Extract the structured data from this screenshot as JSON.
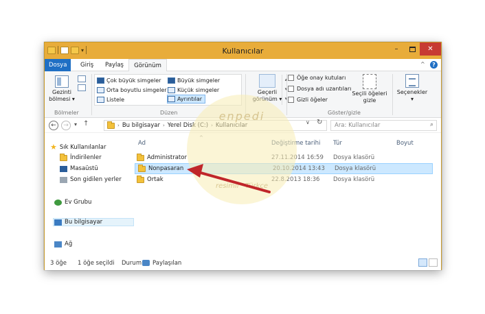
{
  "window": {
    "title": "Kullanıcılar",
    "min": "–",
    "close": "✕"
  },
  "tabs": {
    "file": "Dosya",
    "home": "Giriş",
    "share": "Paylaş",
    "view": "Görünüm"
  },
  "ribbon": {
    "panes": {
      "nav_pane": "Gezinti\nbölmesi ▾",
      "group_label": "Bölmeler"
    },
    "layout": {
      "items": [
        "Çok büyük simgeler",
        "Büyük simgeler",
        "Orta boyutlu simgeler",
        "Küçük simgeler",
        "Listele",
        "Ayrıntılar"
      ],
      "group_label": "Düzen"
    },
    "current_view": {
      "label": "Geçerli\ngörünüm ▾"
    },
    "show_hide": {
      "item_checkboxes": "Öğe onay kutuları",
      "file_extensions": "Dosya adı uzantıları",
      "hidden_items": "Gizli öğeler",
      "hide_selected": "Seçili öğeleri\ngizle",
      "group_label": "Göster/gizle"
    },
    "options": {
      "label": "Seçenekler\n▾"
    }
  },
  "address": {
    "crumbs": [
      "Bu bilgisayar",
      "Yerel Disk (C:)",
      "Kullanıcılar"
    ],
    "search_placeholder": "Ara: Kullanıcılar"
  },
  "nav": {
    "favorites": "Sık Kullanılanlar",
    "downloads": "İndirilenler",
    "desktop": "Masaüstü",
    "recent": "Son gidilen yerler",
    "homegroup": "Ev Grubu",
    "this_pc": "Bu bilgisayar",
    "network": "Ağ"
  },
  "columns": {
    "name": "Ad",
    "date": "Değiştirme tarihi",
    "type": "Tür",
    "size": "Boyut"
  },
  "files": [
    {
      "name": "Administrator",
      "date": "27.11.2014 16:59",
      "type": "Dosya klasörü"
    },
    {
      "name": "Nonpasaran",
      "date": "20.10.2014 13:43",
      "type": "Dosya klasörü"
    },
    {
      "name": "Ortak",
      "date": "22.8.2013 18:36",
      "type": "Dosya klasörü"
    }
  ],
  "status": {
    "count": "3 öğe",
    "selected": "1 öğe seçildi",
    "state": "Durum:",
    "shared": "Paylaşılan"
  },
  "watermark": {
    "top": "enpedi",
    "bottom": "resimli · Türkçe"
  },
  "colors": {
    "titlebar": "#e8ac3a",
    "file_tab": "#1f6fc4",
    "selection": "#cce8ff",
    "arrow": "#c0262a"
  }
}
